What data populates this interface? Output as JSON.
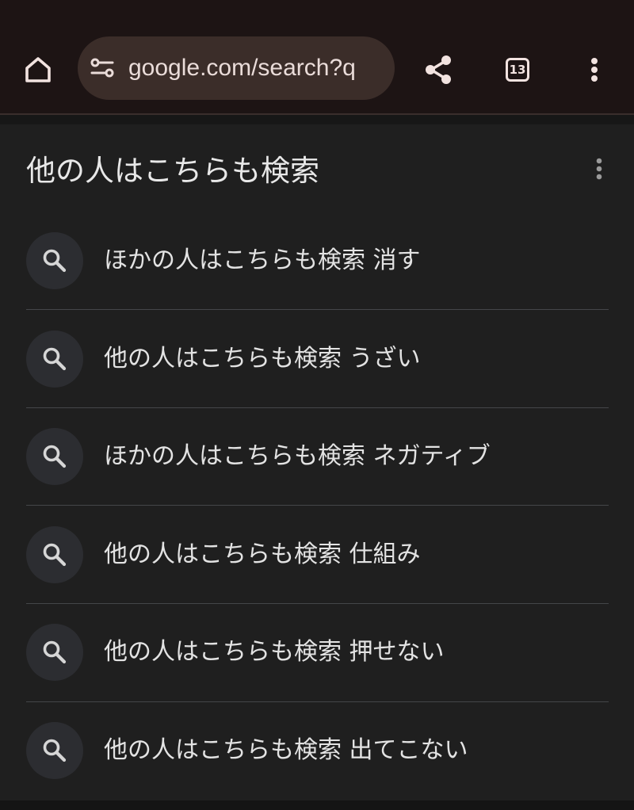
{
  "browser": {
    "url": "google.com/search?q",
    "tab_count": "13",
    "icons": {
      "home": "home-icon",
      "site_settings": "tune-icon",
      "share": "share-icon",
      "tabs": "tab-switcher-icon",
      "menu": "more-vert-icon"
    }
  },
  "related_searches": {
    "title": "他の人はこちらも検索",
    "items": [
      {
        "label": "ほかの人はこちらも検索 消す",
        "icon": "search-icon"
      },
      {
        "label": "他の人はこちらも検索 うざい",
        "icon": "search-icon"
      },
      {
        "label": "ほかの人はこちらも検索 ネガティブ",
        "icon": "search-icon"
      },
      {
        "label": "他の人はこちらも検索 仕組み",
        "icon": "search-icon"
      },
      {
        "label": "他の人はこちらも検索 押せない",
        "icon": "search-icon"
      },
      {
        "label": "他の人はこちらも検索 出てこない",
        "icon": "search-icon"
      }
    ]
  },
  "colors": {
    "toolbar_bg": "#1d1414",
    "omnibox_bg": "#3b2d29",
    "toolbar_icon": "#f2e3e0",
    "page_bg": "#1f1f1f",
    "search_circle_bg": "#2c2d31"
  }
}
